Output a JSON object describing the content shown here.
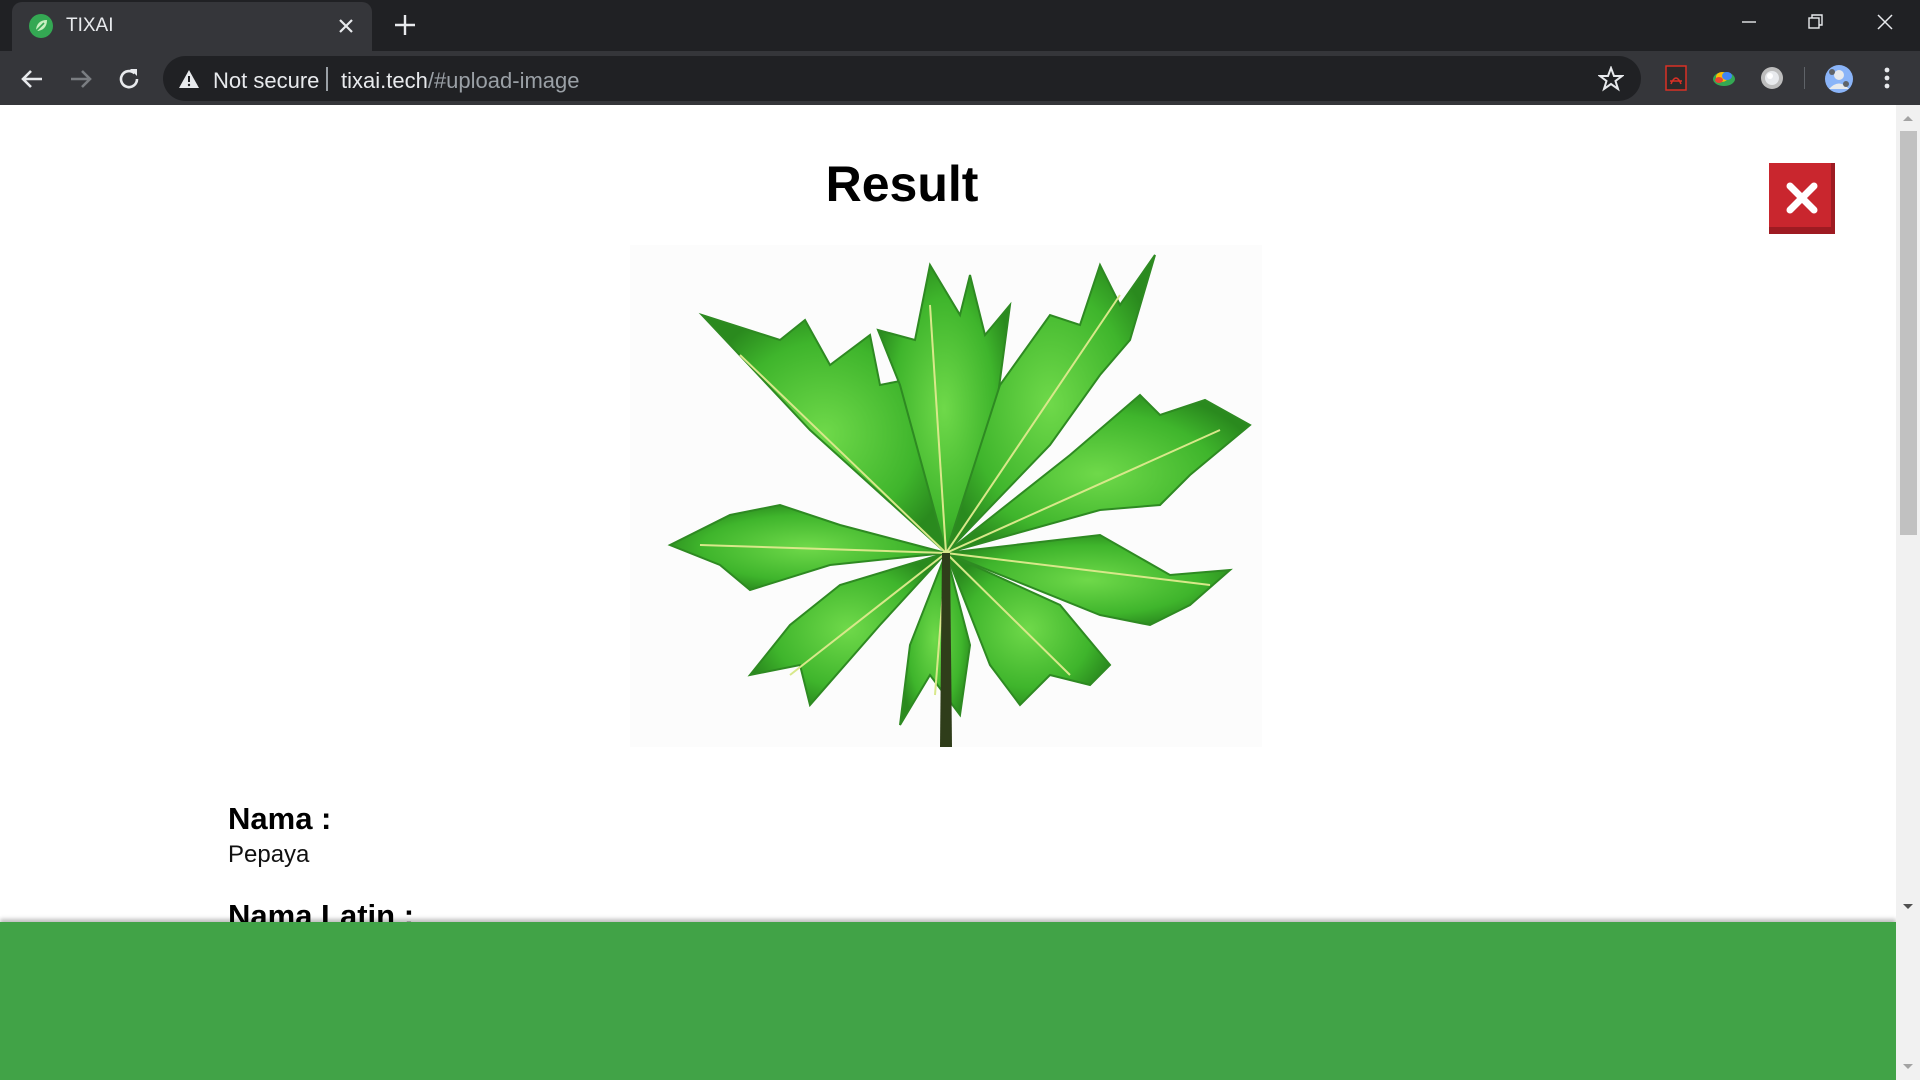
{
  "browser": {
    "tab_title": "TIXAI",
    "security_label": "Not secure",
    "url_host": "tixai.tech",
    "url_path": "/#upload-image"
  },
  "page": {
    "result_title": "Result",
    "name_label": "Nama :",
    "name_value": "Pepaya",
    "latin_label": "Nama Latin :",
    "image_subject": "papaya leaf"
  },
  "colors": {
    "close_button": "#c9262e",
    "footer": "#41a347",
    "leaf": "#4fc33a"
  }
}
